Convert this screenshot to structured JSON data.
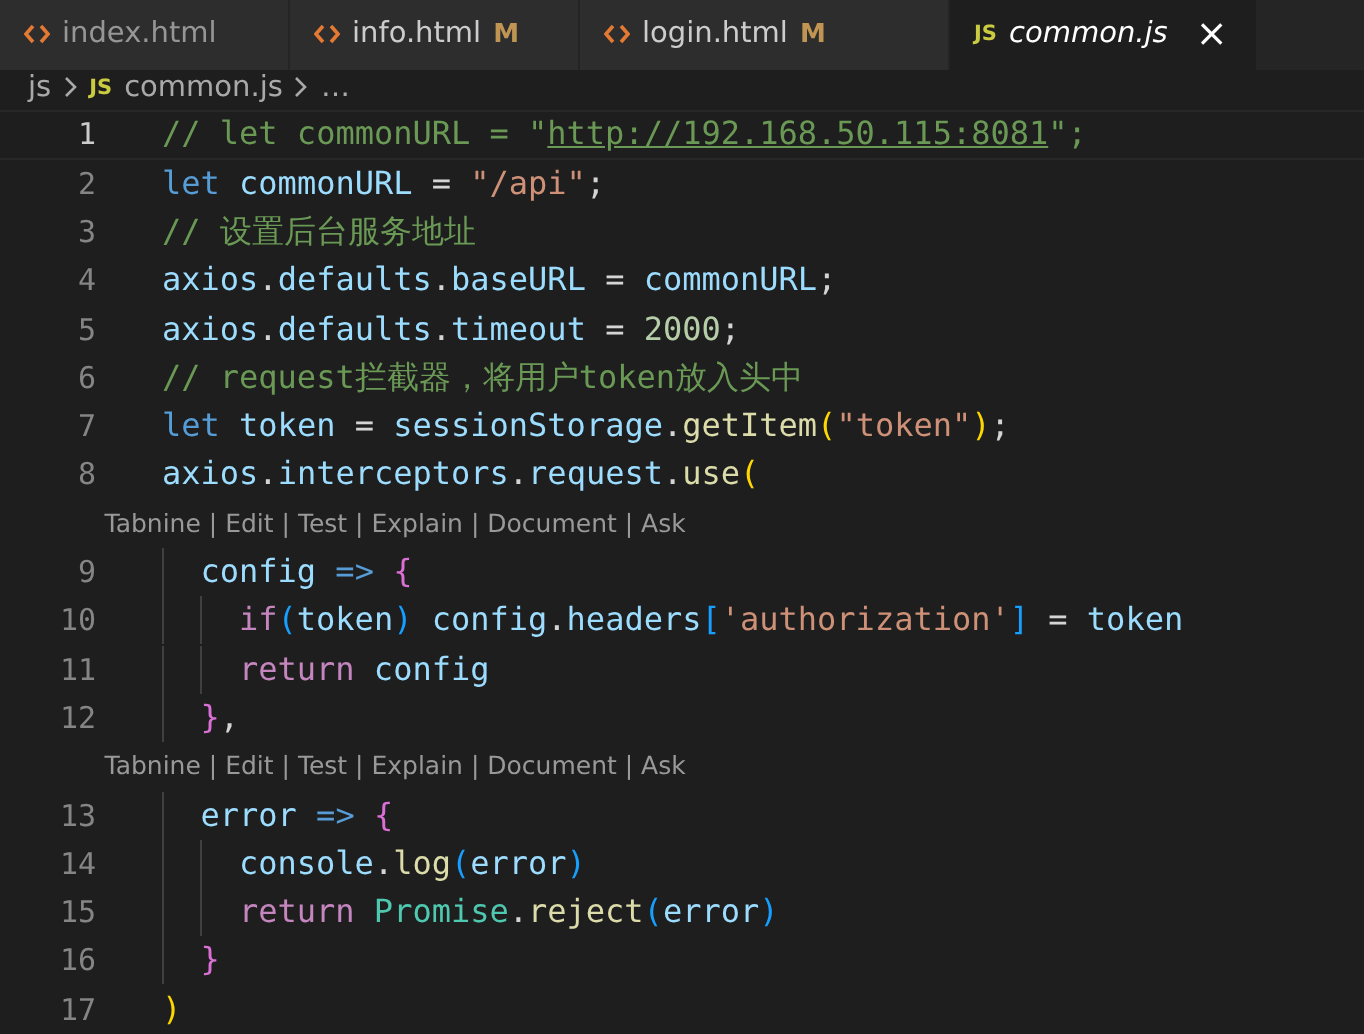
{
  "tabs": [
    {
      "label": "index.html",
      "kind": "html",
      "selected": false,
      "preview": false
    },
    {
      "label": "info.html",
      "kind": "html",
      "modified": "M",
      "selected": false,
      "preview": false
    },
    {
      "label": "login.html",
      "kind": "html",
      "modified": "M",
      "selected": false,
      "preview": false
    },
    {
      "label": "common.js",
      "kind": "js",
      "badge": "JS",
      "selected": true,
      "preview": true,
      "close": "×"
    }
  ],
  "breadcrumb": [
    {
      "label": "js",
      "kind": "folder"
    },
    {
      "label": "common.js",
      "kind": "js",
      "badge": "JS"
    },
    {
      "label": "…",
      "kind": "more"
    }
  ],
  "editor": {
    "rows": [
      {
        "kind": "code",
        "number": "1",
        "current": true,
        "spans": [
          {
            "text": "// let commonURL = \"",
            "color": "#6a9955"
          },
          {
            "text": "http://192.168.50.115:8081",
            "color": "#6a9955",
            "underline": true
          },
          {
            "text": "\";",
            "color": "#6a9955"
          }
        ]
      },
      {
        "kind": "code",
        "number": "2",
        "current": false,
        "spans": [
          {
            "text": "let",
            "color": "#569cd6"
          },
          {
            "text": " commonURL",
            "color": "#9cdcfe"
          },
          {
            "text": " = ",
            "color": "#d4d4d4"
          },
          {
            "text": "\"/api\"",
            "color": "#ce9178"
          },
          {
            "text": ";",
            "color": "#d4d4d4"
          }
        ]
      },
      {
        "kind": "code",
        "number": "3",
        "current": false,
        "spans": [
          {
            "text": "// 设置后台服务地址",
            "color": "#6a9955"
          }
        ]
      },
      {
        "kind": "code",
        "number": "4",
        "current": false,
        "spans": [
          {
            "text": "axios",
            "color": "#9cdcfe"
          },
          {
            "text": ".",
            "color": "#d4d4d4"
          },
          {
            "text": "defaults",
            "color": "#9cdcfe"
          },
          {
            "text": ".",
            "color": "#d4d4d4"
          },
          {
            "text": "baseURL",
            "color": "#9cdcfe"
          },
          {
            "text": " = ",
            "color": "#d4d4d4"
          },
          {
            "text": "commonURL",
            "color": "#9cdcfe"
          },
          {
            "text": ";",
            "color": "#d4d4d4"
          }
        ]
      },
      {
        "kind": "code",
        "number": "5",
        "current": false,
        "spans": [
          {
            "text": "axios",
            "color": "#9cdcfe"
          },
          {
            "text": ".",
            "color": "#d4d4d4"
          },
          {
            "text": "defaults",
            "color": "#9cdcfe"
          },
          {
            "text": ".",
            "color": "#d4d4d4"
          },
          {
            "text": "timeout",
            "color": "#9cdcfe"
          },
          {
            "text": " = ",
            "color": "#d4d4d4"
          },
          {
            "text": "2000",
            "color": "#b5cea8"
          },
          {
            "text": ";",
            "color": "#d4d4d4"
          }
        ]
      },
      {
        "kind": "code",
        "number": "6",
        "current": false,
        "spans": [
          {
            "text": "// request拦截器，将用户token放入头中",
            "color": "#6a9955"
          }
        ]
      },
      {
        "kind": "code",
        "number": "7",
        "current": false,
        "spans": [
          {
            "text": "let",
            "color": "#569cd6"
          },
          {
            "text": " token",
            "color": "#9cdcfe"
          },
          {
            "text": " = ",
            "color": "#d4d4d4"
          },
          {
            "text": "sessionStorage",
            "color": "#9cdcfe"
          },
          {
            "text": ".",
            "color": "#d4d4d4"
          },
          {
            "text": "getItem",
            "color": "#dcdcaa"
          },
          {
            "text": "(",
            "color": "#ffd700"
          },
          {
            "text": "\"token\"",
            "color": "#ce9178"
          },
          {
            "text": ")",
            "color": "#ffd700"
          },
          {
            "text": ";",
            "color": "#d4d4d4"
          }
        ]
      },
      {
        "kind": "code",
        "number": "8",
        "current": false,
        "spans": [
          {
            "text": "axios",
            "color": "#9cdcfe"
          },
          {
            "text": ".",
            "color": "#d4d4d4"
          },
          {
            "text": "interceptors",
            "color": "#9cdcfe"
          },
          {
            "text": ".",
            "color": "#d4d4d4"
          },
          {
            "text": "request",
            "color": "#9cdcfe"
          },
          {
            "text": ".",
            "color": "#d4d4d4"
          },
          {
            "text": "use",
            "color": "#dcdcaa"
          },
          {
            "text": "(",
            "color": "#ffd700"
          }
        ]
      },
      {
        "kind": "codelens",
        "text": "Tabnine | Edit | Test | Explain | Document | Ask"
      },
      {
        "kind": "code",
        "number": "9",
        "current": false,
        "spans": [
          {
            "text": "  config",
            "color": "#9cdcfe"
          },
          {
            "text": " =>",
            "color": "#569cd6"
          },
          {
            "text": " {",
            "color": "#da70d6"
          }
        ]
      },
      {
        "kind": "code",
        "number": "10",
        "current": false,
        "spans": [
          {
            "text": "    if",
            "color": "#c586c0"
          },
          {
            "text": "(",
            "color": "#179fff"
          },
          {
            "text": "token",
            "color": "#9cdcfe"
          },
          {
            "text": ")",
            "color": "#179fff"
          },
          {
            "text": " config",
            "color": "#9cdcfe"
          },
          {
            "text": ".",
            "color": "#d4d4d4"
          },
          {
            "text": "headers",
            "color": "#9cdcfe"
          },
          {
            "text": "[",
            "color": "#179fff"
          },
          {
            "text": "'authorization'",
            "color": "#ce9178"
          },
          {
            "text": "]",
            "color": "#179fff"
          },
          {
            "text": " = ",
            "color": "#d4d4d4"
          },
          {
            "text": "token",
            "color": "#9cdcfe"
          }
        ]
      },
      {
        "kind": "code",
        "number": "11",
        "current": false,
        "spans": [
          {
            "text": "    return",
            "color": "#c586c0"
          },
          {
            "text": " config",
            "color": "#9cdcfe"
          }
        ]
      },
      {
        "kind": "code",
        "number": "12",
        "current": false,
        "spans": [
          {
            "text": "  }",
            "color": "#da70d6"
          },
          {
            "text": ",",
            "color": "#d4d4d4"
          }
        ]
      },
      {
        "kind": "codelens",
        "text": "Tabnine | Edit | Test | Explain | Document | Ask"
      },
      {
        "kind": "code",
        "number": "13",
        "current": false,
        "spans": [
          {
            "text": "  error",
            "color": "#9cdcfe"
          },
          {
            "text": " =>",
            "color": "#569cd6"
          },
          {
            "text": " {",
            "color": "#da70d6"
          }
        ]
      },
      {
        "kind": "code",
        "number": "14",
        "current": false,
        "spans": [
          {
            "text": "    console",
            "color": "#9cdcfe"
          },
          {
            "text": ".",
            "color": "#d4d4d4"
          },
          {
            "text": "log",
            "color": "#dcdcaa"
          },
          {
            "text": "(",
            "color": "#179fff"
          },
          {
            "text": "error",
            "color": "#9cdcfe"
          },
          {
            "text": ")",
            "color": "#179fff"
          }
        ]
      },
      {
        "kind": "code",
        "number": "15",
        "current": false,
        "spans": [
          {
            "text": "    return",
            "color": "#c586c0"
          },
          {
            "text": " Promise",
            "color": "#4ec9b0"
          },
          {
            "text": ".",
            "color": "#d4d4d4"
          },
          {
            "text": "reject",
            "color": "#dcdcaa"
          },
          {
            "text": "(",
            "color": "#179fff"
          },
          {
            "text": "error",
            "color": "#9cdcfe"
          },
          {
            "text": ")",
            "color": "#179fff"
          }
        ]
      },
      {
        "kind": "code",
        "number": "16",
        "current": false,
        "spans": [
          {
            "text": "  }",
            "color": "#da70d6"
          }
        ]
      },
      {
        "kind": "code",
        "number": "17",
        "current": false,
        "spans": [
          {
            "text": ")",
            "color": "#ffd700"
          }
        ]
      }
    ]
  }
}
